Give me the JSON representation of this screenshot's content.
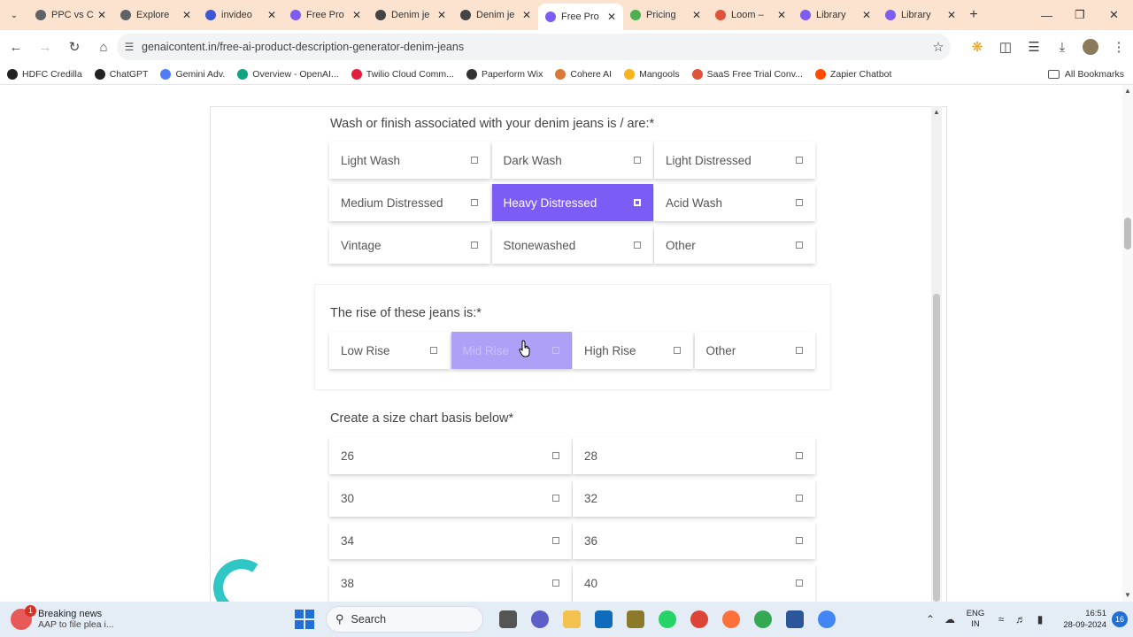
{
  "browser": {
    "tabs": [
      {
        "title": "PPC vs C",
        "color": "#5f6368"
      },
      {
        "title": "Explore",
        "color": "#5f6368"
      },
      {
        "title": "invideo",
        "color": "#3d56d6"
      },
      {
        "title": "Free Pro",
        "color": "#7b5cf5"
      },
      {
        "title": "Denim je",
        "color": "#444444"
      },
      {
        "title": "Denim je",
        "color": "#444444"
      },
      {
        "title": "Free Pro",
        "color": "#7b5cf5",
        "active": true
      },
      {
        "title": "Pricing",
        "color": "#4caf50"
      },
      {
        "title": "Loom –",
        "color": "#e0533b"
      },
      {
        "title": "Library",
        "color": "#7b5cf5"
      },
      {
        "title": "Library",
        "color": "#7b5cf5"
      }
    ],
    "url": "genaicontent.in/free-ai-product-description-generator-denim-jeans",
    "bookmarks": [
      {
        "label": "HDFC Credilla",
        "color": "#222222"
      },
      {
        "label": "ChatGPT",
        "color": "#222222"
      },
      {
        "label": "Gemini Adv.",
        "color": "#4f7df5"
      },
      {
        "label": "Overview - OpenAI...",
        "color": "#10a37f"
      },
      {
        "label": "Twilio Cloud Comm...",
        "color": "#e31e3c"
      },
      {
        "label": "Paperform Wix",
        "color": "#333333"
      },
      {
        "label": "Cohere AI",
        "color": "#d97a3b"
      },
      {
        "label": "Mangools",
        "color": "#f5b41c"
      },
      {
        "label": "SaaS Free Trial Conv...",
        "color": "#e0533b"
      },
      {
        "label": "Zapier Chatbot",
        "color": "#ff4a00"
      }
    ],
    "all_bookmarks": "All Bookmarks"
  },
  "form": {
    "wash": {
      "question": "Wash or finish associated with your denim jeans is / are:*",
      "options": [
        "Light Wash",
        "Dark Wash",
        "Light Distressed",
        "Medium Distressed",
        "Heavy Distressed",
        "Acid Wash",
        "Vintage",
        "Stonewashed",
        "Other"
      ],
      "selected": "Heavy Distressed"
    },
    "rise": {
      "question": "The rise of these jeans is:*",
      "options": [
        "Low Rise",
        "Mid Rise",
        "High Rise",
        "Other"
      ],
      "hovered": "Mid Rise"
    },
    "size": {
      "question": "Create a size chart basis below*",
      "options": [
        "26",
        "28",
        "30",
        "32",
        "34",
        "36",
        "38",
        "40"
      ]
    },
    "accent_color": "#7b5cf5"
  },
  "taskbar": {
    "news_title": "Breaking news",
    "news_sub": "AAP to file plea i...",
    "news_badge": "1",
    "search_label": "Search",
    "lang_1": "ENG",
    "lang_2": "IN",
    "time": "16:51",
    "date": "28-09-2024",
    "notif_count": "16"
  }
}
